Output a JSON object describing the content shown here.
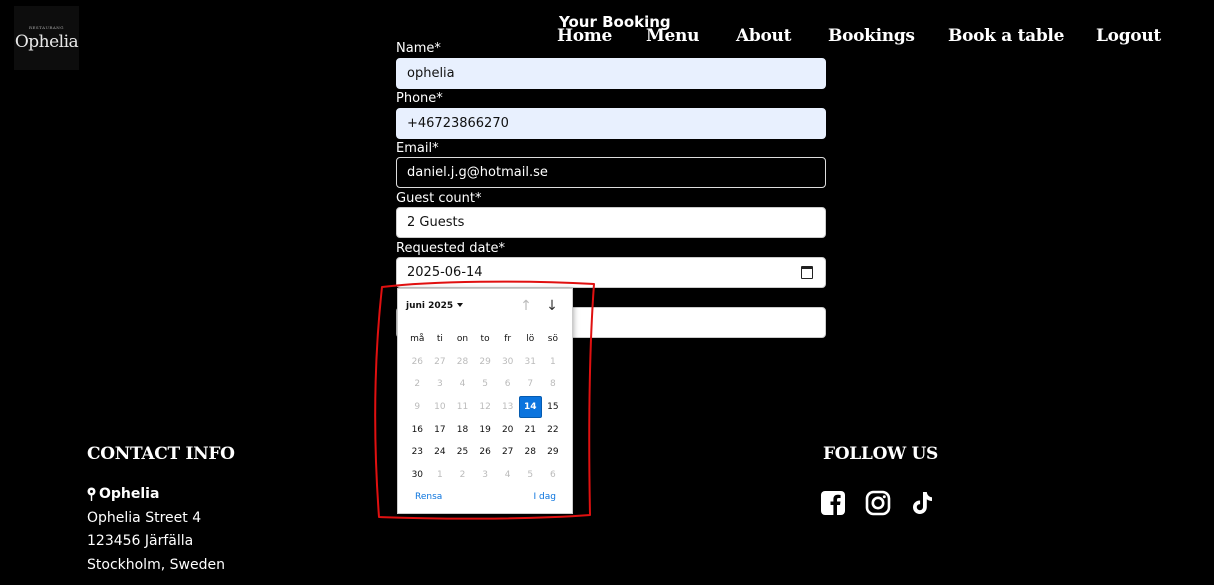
{
  "logo": {
    "tagline": "RESTAURANG",
    "name": "Ophelia"
  },
  "page_title": "Your Booking",
  "nav": [
    "Home",
    "Menu",
    "About",
    "Bookings",
    "Book a table",
    "Logout"
  ],
  "form": {
    "name": {
      "label": "Name*",
      "value": "ophelia"
    },
    "phone": {
      "label": "Phone*",
      "value": "+46723866270"
    },
    "email": {
      "label": "Email*",
      "value": "daniel.j.g@hotmail.se"
    },
    "guests": {
      "label": "Guest count*",
      "value": "2 Guests"
    },
    "date": {
      "label": "Requested date*",
      "value": "2025-06-14"
    },
    "time": {
      "value": ""
    }
  },
  "datepicker": {
    "month_label": "juni 2025",
    "weekdays": [
      "må",
      "ti",
      "on",
      "to",
      "fr",
      "lö",
      "sö"
    ],
    "weeks": [
      [
        "26",
        "27",
        "28",
        "29",
        "30",
        "31",
        "1"
      ],
      [
        "2",
        "3",
        "4",
        "5",
        "6",
        "7",
        "8"
      ],
      [
        "9",
        "10",
        "11",
        "12",
        "13",
        "14",
        "15"
      ],
      [
        "16",
        "17",
        "18",
        "19",
        "20",
        "21",
        "22"
      ],
      [
        "23",
        "24",
        "25",
        "26",
        "27",
        "28",
        "29"
      ],
      [
        "30",
        "1",
        "2",
        "3",
        "4",
        "5",
        "6"
      ]
    ],
    "disabled_until_week_day": [
      2,
      4
    ],
    "selected": [
      2,
      5
    ],
    "clear_label": "Rensa",
    "today_label": "I dag"
  },
  "contact": {
    "title": "CONTACT INFO",
    "name": "Ophelia",
    "street": "Ophelia Street 4",
    "postcode": "123456 Järfälla",
    "city": "Stockholm, Sweden"
  },
  "follow": {
    "title": "FOLLOW US",
    "icons": [
      "facebook-icon",
      "instagram-icon",
      "tiktok-icon"
    ]
  },
  "colors": {
    "accent": "#0b74de",
    "annotation": "#e01010",
    "autofill": "#e8f0fe"
  }
}
